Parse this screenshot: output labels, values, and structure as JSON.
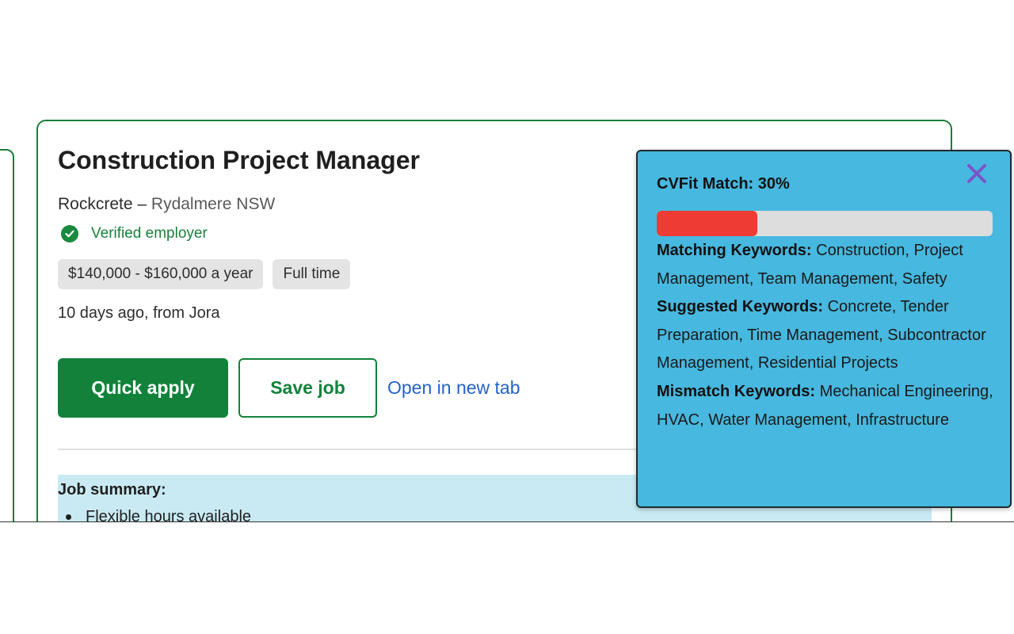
{
  "job": {
    "title": "Construction Project Manager",
    "company": "Rockcrete",
    "separator": "–",
    "location": "Rydalmere NSW",
    "verified_label": "Verified employer",
    "tags": [
      "$140,000 - $160,000 a year",
      "Full time"
    ],
    "posted": "10 days ago, from Jora",
    "actions": {
      "quick_apply_label": "Quick apply",
      "save_job_label": "Save job",
      "open_new_tab_label": "Open in new tab"
    },
    "summary": {
      "title": "Job summary:",
      "items": [
        "Flexible hours available"
      ]
    }
  },
  "cvfit": {
    "title": "CVFit Match: 30%",
    "match_percent": 30,
    "matching_label": "Matching Keywords:",
    "matching_keywords": "Construction, Project Management, Team Management, Safety",
    "suggested_label": "Suggested Keywords:",
    "suggested_keywords": "Concrete, Tender Preparation, Time Management, Subcontractor Management, Residential Projects",
    "mismatch_label": "Mismatch Keywords:",
    "mismatch_keywords": "Mechanical Engineering, HVAC, Water Management, Infrastructure"
  },
  "colors": {
    "brand_green": "#12823b",
    "link_blue": "#2563c9",
    "popup_bg": "#47b8df",
    "progress_fill": "#ee3b33",
    "close_icon": "#7a55c9"
  },
  "icons": {
    "verified": "check-circle-icon",
    "close": "close-icon"
  }
}
